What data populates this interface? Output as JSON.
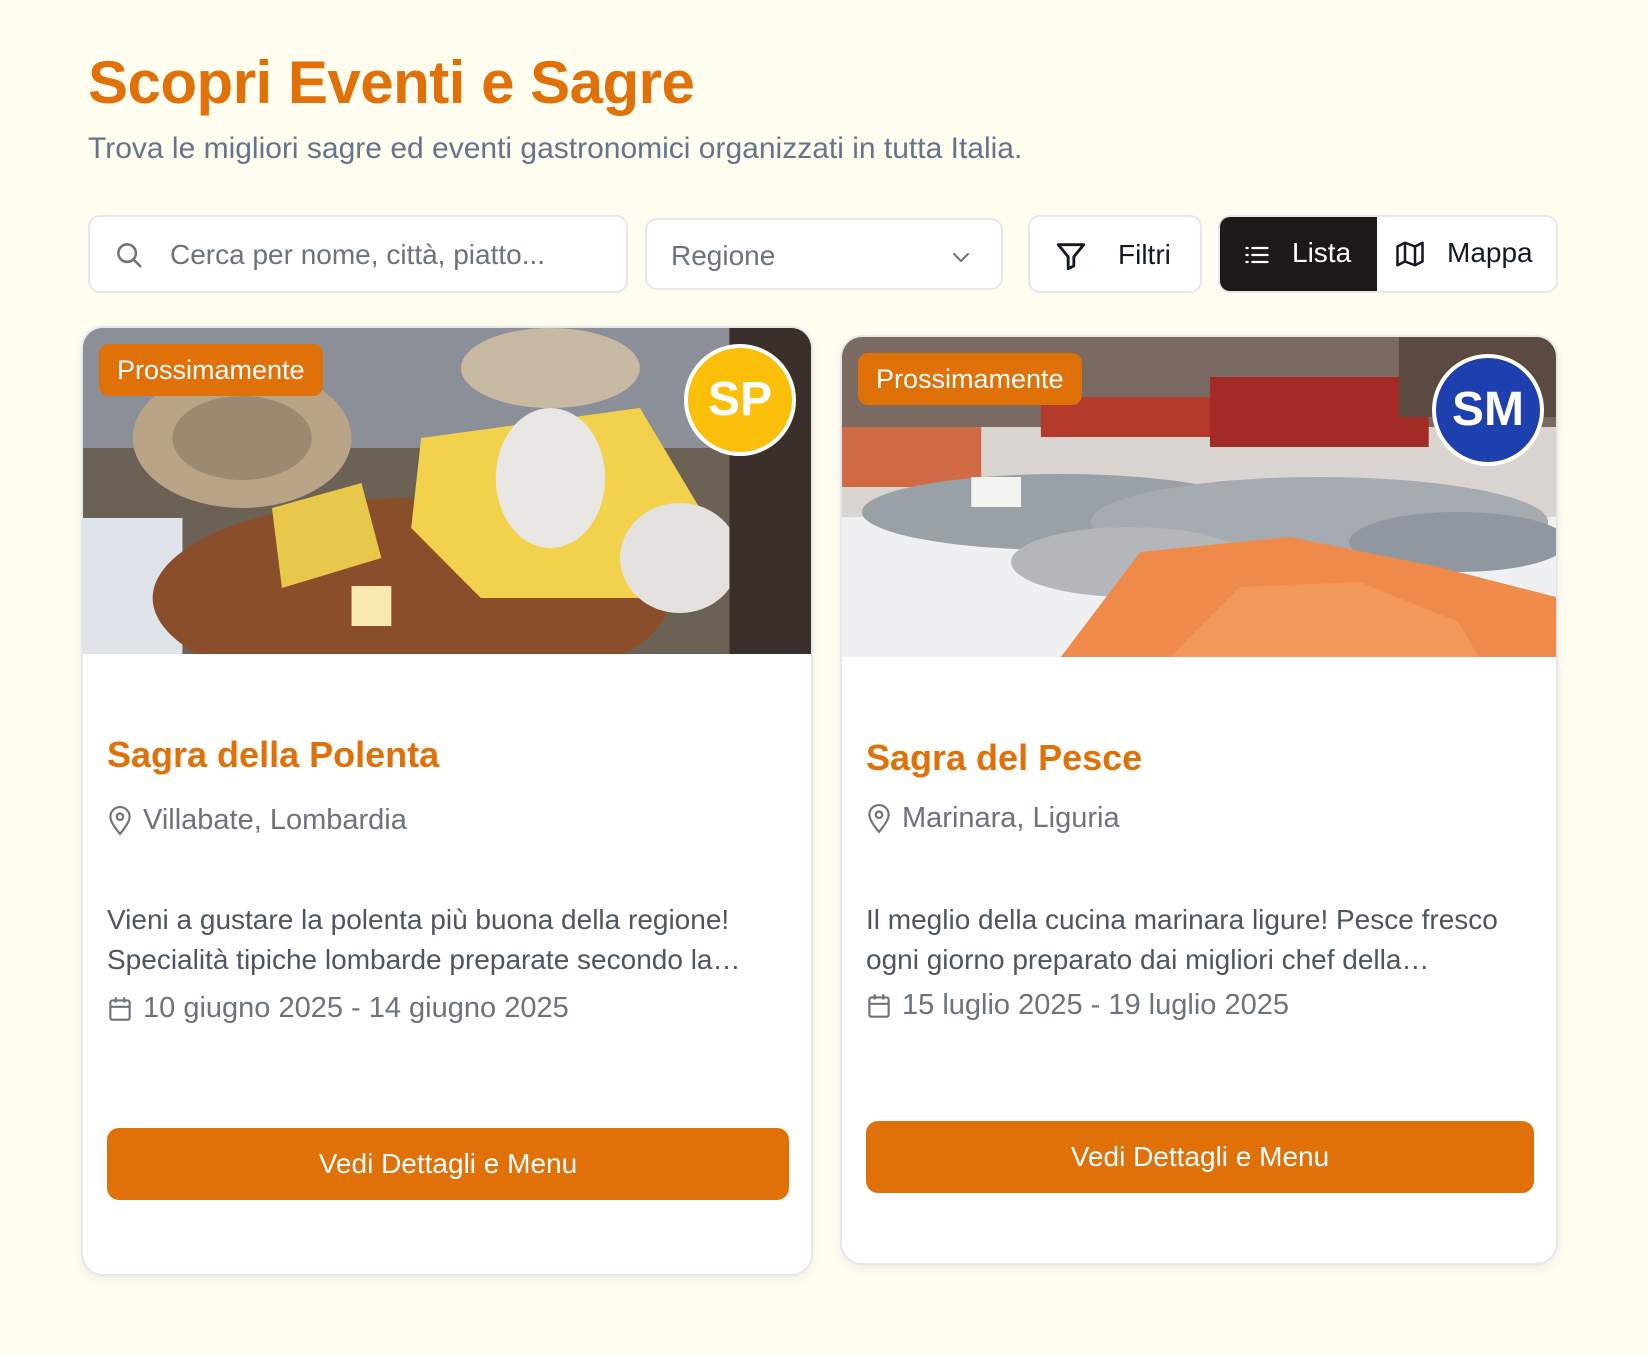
{
  "header": {
    "title": "Scopri Eventi e Sagre",
    "subtitle": "Trova le migliori sagre ed eventi gastronomici organizzati in tutta Italia."
  },
  "toolbar": {
    "search_placeholder": "Cerca per nome, città, piatto...",
    "search_value": "",
    "region_label": "Regione",
    "filters_label": "Filtri",
    "view_list_label": "Lista",
    "view_map_label": "Mappa",
    "active_view": "Lista"
  },
  "colors": {
    "accent": "#e07008",
    "background": "#fffcf0",
    "list_active": "#1c1917"
  },
  "events": [
    {
      "badge": "Prossimamente",
      "avatar_initials": "SP",
      "avatar_color": "#fbbf0a",
      "title": "Sagra della Polenta",
      "location": "Villabate, Lombardia",
      "description": "Vieni a gustare la polenta più buona della regione! Specialità tipiche lombarde preparate secondo la…",
      "dates": "10 giugno 2025 - 14 giugno 2025",
      "button_label": "Vedi Dettagli e Menu",
      "image": "polenta-photo"
    },
    {
      "badge": "Prossimamente",
      "avatar_initials": "SM",
      "avatar_color": "#1e40af",
      "title": "Sagra del Pesce",
      "location": "Marinara, Liguria",
      "description": "Il meglio della cucina marinara ligure! Pesce fresco ogni giorno preparato dai migliori chef della…",
      "dates": "15 luglio 2025 - 19 luglio 2025",
      "button_label": "Vedi Dettagli e Menu",
      "image": "fish-market-photo"
    }
  ]
}
